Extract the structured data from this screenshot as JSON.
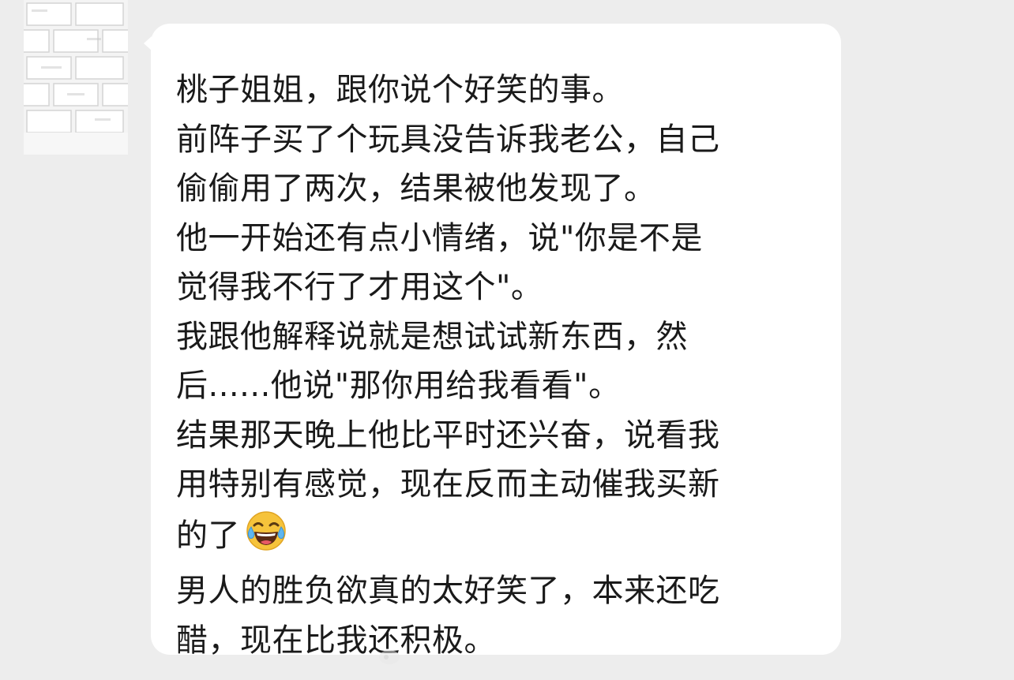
{
  "chat": {
    "message": {
      "lines": [
        "桃子姐姐，跟你说个好笑的事。",
        "前阵子买了个玩具没告诉我老公，自己",
        "偷偷用了两次，结果被他发现了。",
        "他一开始还有点小情绪，说\"你是不是",
        "觉得我不行了才用这个\"。",
        "我跟他解释说就是想试试新东西，然",
        "后......他说\"那你用给我看看\"。",
        "结果那天晚上他比平时还兴奋，说看我",
        "用特别有感觉，现在反而主动催我买新",
        "的了",
        "男人的胜负欲真的太好笑了，本来还吃",
        "醋，现在比我还积极。"
      ],
      "emoji_icon": "face-with-tears-of-joy-icon"
    },
    "avatar_icon": "brick-wall-avatar",
    "colors": {
      "background": "#ededed",
      "bubble": "#ffffff",
      "text": "#1a1a1a"
    }
  }
}
